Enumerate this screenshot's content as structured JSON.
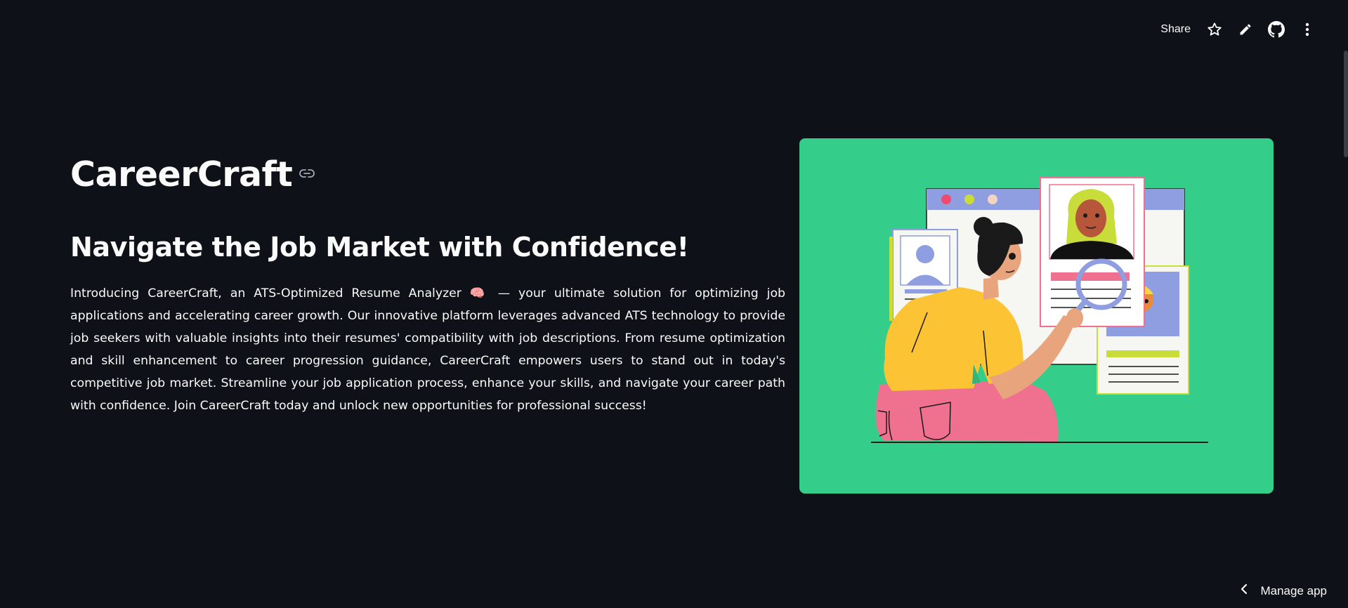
{
  "toolbar": {
    "share_label": "Share",
    "icons": [
      "star-icon",
      "pencil-icon",
      "github-icon",
      "kebab-menu-icon"
    ]
  },
  "header": {
    "title": "CareerCraft",
    "anchor_icon": "link-icon"
  },
  "main": {
    "subtitle": "Navigate the Job Market with Confidence!",
    "description": "Introducing CareerCraft, an ATS-Optimized Resume Analyzer 🧠 — your ultimate solution for optimizing job applications and accelerating career growth. Our innovative platform leverages advanced ATS technology to provide job seekers with valuable insights into their resumes' compatibility with job descriptions. From resume optimization and skill enhancement to career progression guidance, CareerCraft empowers users to stand out in today's competitive job market. Streamline your job application process, enhance your skills, and navigate your career path with confidence. Join CareerCraft today and unlock new opportunities for professional success!"
  },
  "hero": {
    "background_color": "#34cd8a"
  },
  "footer": {
    "manage_label": "Manage app",
    "manage_icon": "chevron-left-icon"
  },
  "colors": {
    "background": "#0e1117",
    "text": "#fafafa"
  }
}
